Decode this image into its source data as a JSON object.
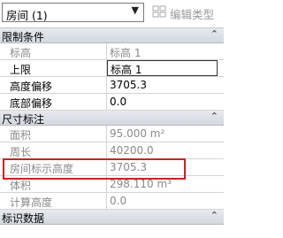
{
  "type_selector": {
    "value": "房间 (1)"
  },
  "edit_type": {
    "label": "编辑类型"
  },
  "sections": {
    "constraints": {
      "title": "限制条件",
      "toggle": "⌃"
    },
    "dimensions": {
      "title": "尺寸标注",
      "toggle": "⌃"
    },
    "identity": {
      "title": "标识数据",
      "toggle": "⌃"
    }
  },
  "constraints_rows": [
    {
      "name": "标高",
      "value": "标高 1"
    },
    {
      "name": "上限",
      "value": "标高 1"
    },
    {
      "name": "高度偏移",
      "value": "3705.3"
    },
    {
      "name": "底部偏移",
      "value": "0.0"
    }
  ],
  "dimension_rows": [
    {
      "name": "面积",
      "value": "95.000 m²"
    },
    {
      "name": "周长",
      "value": "40200.0"
    },
    {
      "name": "房间标示高度",
      "value": "3705.3"
    },
    {
      "name": "体积",
      "value": "298.110 m³"
    },
    {
      "name": "计算高度",
      "value": "0.0"
    }
  ],
  "colors": {
    "highlight": "#d21f1f",
    "section_bg": "#dde1e6"
  }
}
